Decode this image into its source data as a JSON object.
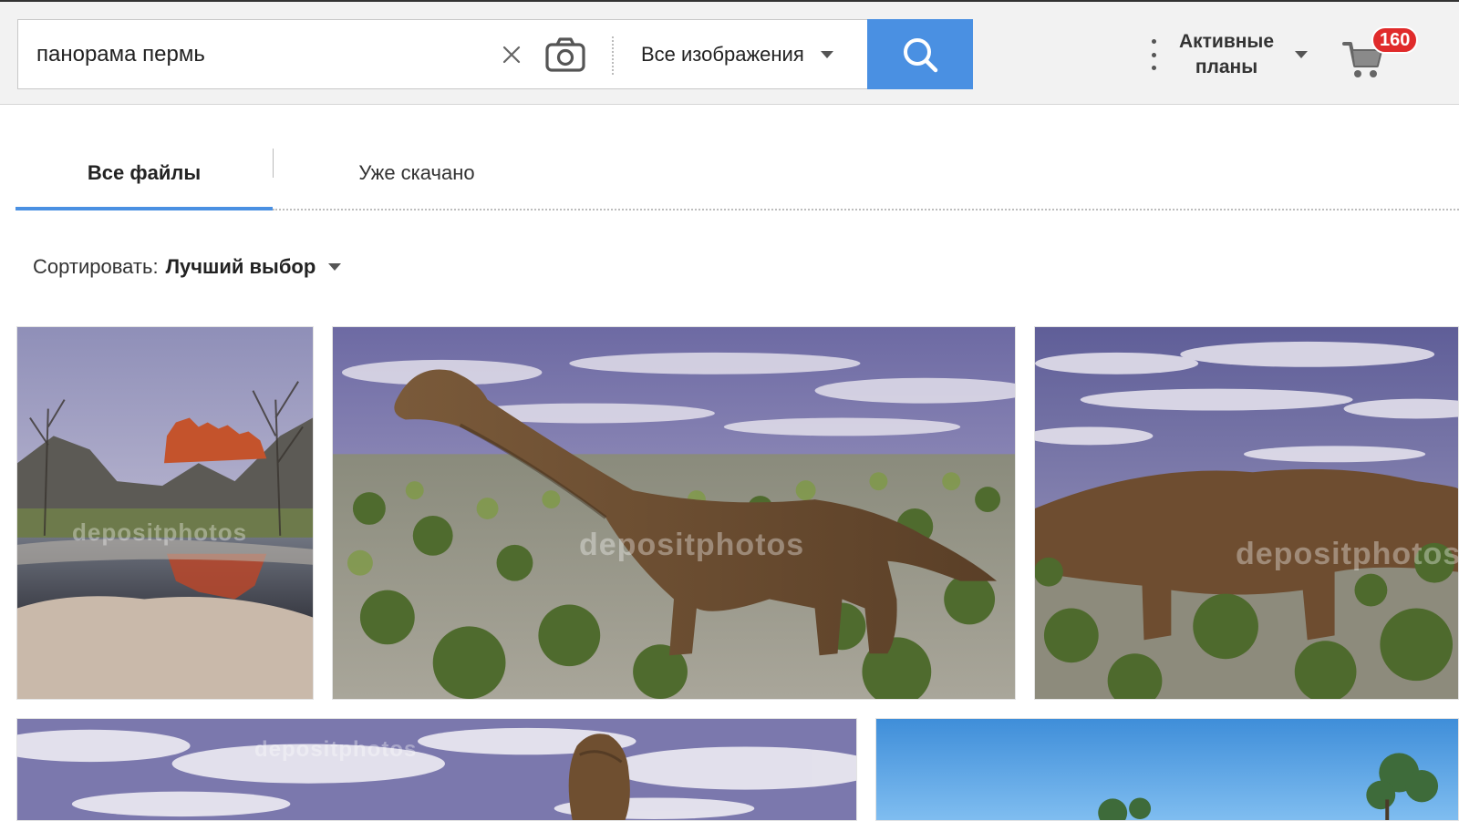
{
  "search": {
    "query": "панорама пермь",
    "type_filter": "Все изображения"
  },
  "header": {
    "plans_line1": "Активные",
    "plans_line2": "планы",
    "cart_count": "160"
  },
  "tabs": [
    {
      "label": "Все файлы",
      "active": true
    },
    {
      "label": "Уже скачано",
      "active": false
    }
  ],
  "sort": {
    "label": "Сортировать:",
    "value": "Лучший выбор"
  },
  "results": [
    {
      "subject": "red-rock-river-landscape",
      "watermark": "depositphotos"
    },
    {
      "subject": "brachiosaurus-dinosaur-swamp",
      "watermark": "depositphotos"
    },
    {
      "subject": "dinosaur-swamp-cropped",
      "watermark": "depositphotos"
    },
    {
      "subject": "dinosaur-sky-landscape",
      "watermark": "depositphotos"
    },
    {
      "subject": "blue-sky-trees-landscape",
      "watermark": ""
    }
  ],
  "colors": {
    "accent": "#4a90e2",
    "badge": "#e02b2b",
    "header_bg": "#f2f2f2"
  },
  "icons": [
    "close-icon",
    "camera-icon",
    "chevron-down-icon",
    "search-icon",
    "more-vertical-icon",
    "cart-icon"
  ]
}
